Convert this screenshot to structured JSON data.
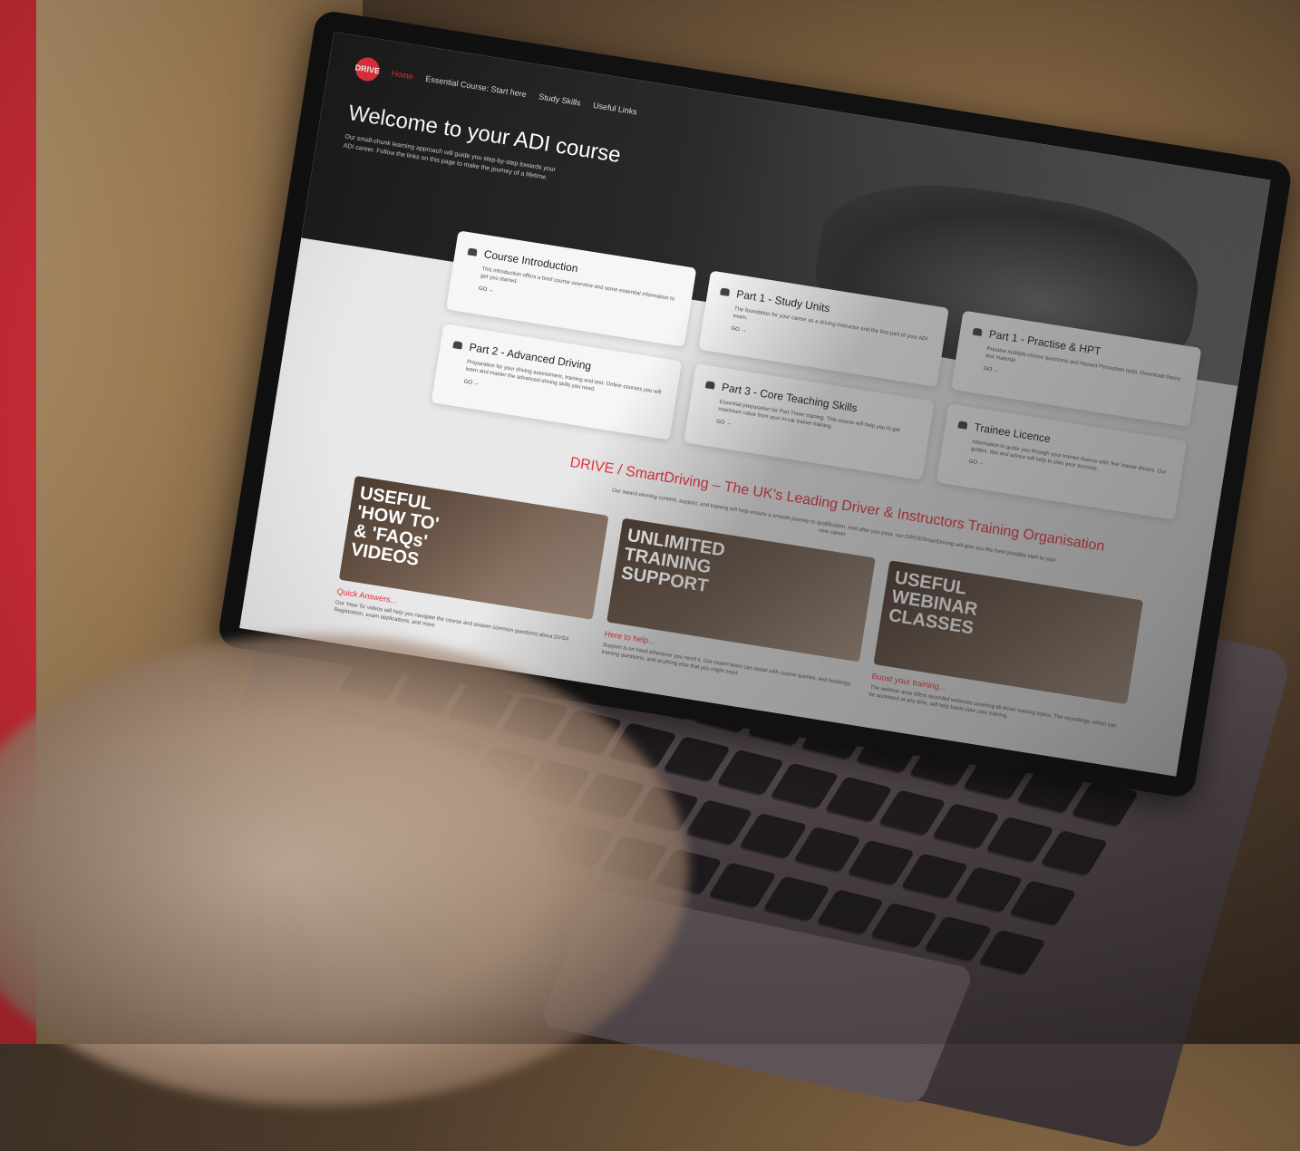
{
  "site": {
    "logo_text": "DRIVE",
    "nav": [
      "Home",
      "Essential Course: Start here",
      "Study Skills",
      "Useful Links"
    ],
    "hero_title": "Welcome to your ADI course",
    "hero_subtitle": "Our small-chunk learning approach will guide you step-by-step towards your ADI career. Follow the links on this page to make the journey of a lifetime."
  },
  "cards": [
    {
      "title": "Course Introduction",
      "desc": "This introduction offers a brief course overview and some essential information to get you started.",
      "go": "GO →"
    },
    {
      "title": "Part 1 - Study Units",
      "desc": "The foundation for your career as a driving instructor and the first part of your ADI exam.",
      "go": "GO →"
    },
    {
      "title": "Part 1 - Practise & HPT",
      "desc": "Practise multiple-choice questions and Hazard Perception tests. Download theory test material.",
      "go": "GO →"
    },
    {
      "title": "Part 2 - Advanced Driving",
      "desc": "Preparation for your driving assessment, training and test. Online courses you will learn and master the advanced driving skills you need.",
      "go": "GO →"
    },
    {
      "title": "Part 3 - Core Teaching Skills",
      "desc": "Essential preparation for Part Three training. This course will help you to get maximum value from your in-car trainer training.",
      "go": "GO →"
    },
    {
      "title": "Trainee Licence",
      "desc": "Information to guide you through your trainee licence with 'live' trainer drivers. Our guides, tips and advice will help to plan your success.",
      "go": "GO →"
    }
  ],
  "org": {
    "title": "DRIVE / SmartDriving – The UK's Leading Driver & Instructors Training Organisation",
    "subtitle": "Our award-winning content, support, and training will help ensure a smooth journey to qualification. And after you pass, our DRIVE/SmartDriving will give you the best possible start to your new career."
  },
  "promos": [
    {
      "image_text": "USEFUL\n'HOW TO'\n& 'FAQs'\nVIDEOS",
      "link": "Quick Answers...",
      "text": "Our 'How To' videos will help you navigate the course and answer common questions about DVSA Registration, exam applications, and more."
    },
    {
      "image_text": "UNLIMITED\nTRAINING\nSUPPORT",
      "link": "Here to help...",
      "text": "Support is on hand whenever you need it. Our expert team can assist with course queries, test bookings, training questions, and anything else that you might need."
    },
    {
      "image_text": "USEFUL\nWEBINAR\nCLASSES",
      "link": "Boost your training...",
      "text": "The webinar area offers recorded webinars covering all driver training topics. The recordings, which can be accessed at any time, will help boost your core training."
    }
  ],
  "colors": {
    "accent": "#e6323e",
    "screen_bg": "#e8e8e8",
    "laptop": "#4d4346"
  },
  "icons": [
    "car-icon"
  ]
}
